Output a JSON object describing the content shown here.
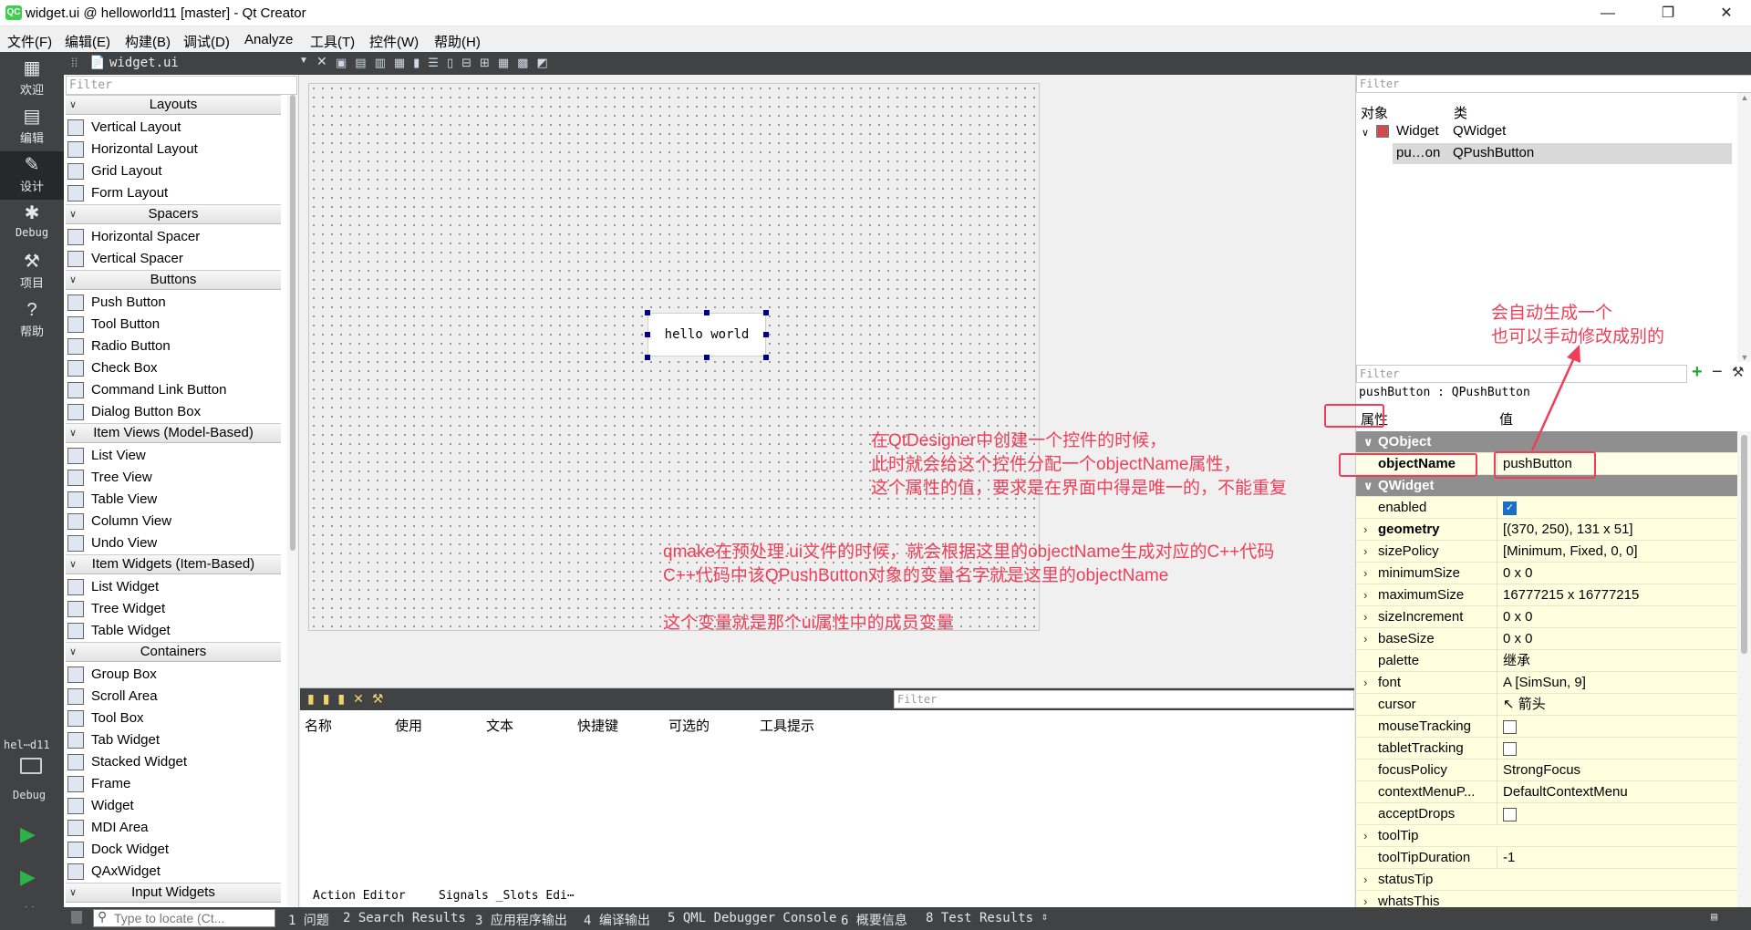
{
  "window": {
    "title": "widget.ui @ helloworld11 [master] - Qt Creator",
    "logo": "QC"
  },
  "menubar": [
    "文件(F)",
    "编辑(E)",
    "构建(B)",
    "调试(D)",
    "Analyze",
    "工具(T)",
    "控件(W)",
    "帮助(H)"
  ],
  "modebar": {
    "modes": [
      {
        "label": "欢迎",
        "icon": "grid-icon"
      },
      {
        "label": "编辑",
        "icon": "document-icon"
      },
      {
        "label": "设计",
        "icon": "pencil-icon",
        "active": true
      },
      {
        "label": "Debug",
        "icon": "bug-icon"
      },
      {
        "label": "项目",
        "icon": "wrench-icon"
      },
      {
        "label": "帮助",
        "icon": "help-icon"
      }
    ],
    "project": "hel⋯d11",
    "kit": "Debug"
  },
  "editor": {
    "file_tab": "widget.ui"
  },
  "widgetbox": {
    "filter_placeholder": "Filter",
    "categories": [
      {
        "name": "Layouts",
        "items": [
          "Vertical Layout",
          "Horizontal Layout",
          "Grid Layout",
          "Form Layout"
        ]
      },
      {
        "name": "Spacers",
        "items": [
          "Horizontal Spacer",
          "Vertical Spacer"
        ]
      },
      {
        "name": "Buttons",
        "items": [
          "Push Button",
          "Tool Button",
          "Radio Button",
          "Check Box",
          "Command Link Button",
          "Dialog Button Box"
        ]
      },
      {
        "name": "Item Views (Model-Based)",
        "items": [
          "List View",
          "Tree View",
          "Table View",
          "Column View",
          "Undo View"
        ]
      },
      {
        "name": "Item Widgets (Item-Based)",
        "items": [
          "List Widget",
          "Tree Widget",
          "Table Widget"
        ]
      },
      {
        "name": "Containers",
        "items": [
          "Group Box",
          "Scroll Area",
          "Tool Box",
          "Tab Widget",
          "Stacked Widget",
          "Frame",
          "Widget",
          "MDI Area",
          "Dock Widget",
          "QAxWidget"
        ]
      },
      {
        "name": "Input Widgets",
        "items": []
      }
    ]
  },
  "form": {
    "button_text": "hello world"
  },
  "action_editor": {
    "filter_placeholder": "Filter",
    "columns": [
      "名称",
      "使用",
      "文本",
      "快捷键",
      "可选的",
      "工具提示"
    ],
    "tabs": [
      "Action Editor",
      "Signals _Slots Edi⋯"
    ]
  },
  "object_inspector": {
    "filter_placeholder": "Filter",
    "col_object": "对象",
    "col_class": "类",
    "rows": [
      {
        "object": "Widget",
        "class": "QWidget"
      },
      {
        "object": "pu…on",
        "class": "QPushButton"
      }
    ]
  },
  "property_editor": {
    "filter_placeholder": "Filter",
    "current": "pushButton : QPushButton",
    "col_prop": "属性",
    "col_value": "值",
    "rows": [
      {
        "kind": "header",
        "name": "QObject"
      },
      {
        "kind": "prop",
        "name": "objectName",
        "value": "pushButton",
        "bold": true
      },
      {
        "kind": "header",
        "name": "QWidget"
      },
      {
        "kind": "check",
        "name": "enabled",
        "checked": true
      },
      {
        "kind": "prop",
        "name": "geometry",
        "value": "[(370, 250), 131 x 51]",
        "bold": true,
        "expand": true
      },
      {
        "kind": "prop",
        "name": "sizePolicy",
        "value": "[Minimum, Fixed, 0, 0]",
        "expand": true
      },
      {
        "kind": "prop",
        "name": "minimumSize",
        "value": "0 x 0",
        "expand": true
      },
      {
        "kind": "prop",
        "name": "maximumSize",
        "value": "16777215 x 16777215",
        "expand": true
      },
      {
        "kind": "prop",
        "name": "sizeIncrement",
        "value": "0 x 0",
        "expand": true
      },
      {
        "kind": "prop",
        "name": "baseSize",
        "value": "0 x 0",
        "expand": true
      },
      {
        "kind": "prop",
        "name": "palette",
        "value": "继承"
      },
      {
        "kind": "prop",
        "name": "font",
        "value": "A  [SimSun, 9]",
        "expand": true
      },
      {
        "kind": "prop",
        "name": "cursor",
        "value": "↖  箭头"
      },
      {
        "kind": "check",
        "name": "mouseTracking",
        "checked": false
      },
      {
        "kind": "check",
        "name": "tabletTracking",
        "checked": false
      },
      {
        "kind": "prop",
        "name": "focusPolicy",
        "value": "StrongFocus"
      },
      {
        "kind": "prop",
        "name": "contextMenuP...",
        "value": "DefaultContextMenu"
      },
      {
        "kind": "check",
        "name": "acceptDrops",
        "checked": false
      },
      {
        "kind": "prop",
        "name": "toolTip",
        "value": "",
        "expand": true
      },
      {
        "kind": "prop",
        "name": "toolTipDuration",
        "value": "-1"
      },
      {
        "kind": "prop",
        "name": "statusTip",
        "value": "",
        "expand": true
      },
      {
        "kind": "prop",
        "name": "whatsThis",
        "value": "",
        "expand": true
      }
    ]
  },
  "annotations": {
    "top_right": [
      "会自动生成一个",
      "也可以手动修改成别的"
    ],
    "middle": [
      "在QtDesigner中创建一个控件的时候，",
      "此时就会给这个控件分配一个objectName属性，",
      "这个属性的值，要求是在界面中得是唯一的，不能重复"
    ],
    "bottom": [
      "qmake在预处理.ui文件的时候，就会根据这里的objectName生成对应的C++代码",
      "C++代码中该QPushButton对象的变量名字就是这里的objectName",
      "",
      "这个变量就是那个ui属性中的成员变量"
    ],
    "color": "#f03e58"
  },
  "statusbar": {
    "locate_placeholder": "Type to locate (Ct...",
    "panes": [
      "1 问题",
      "2 Search Results",
      "3 应用程序输出",
      "4 编译输出",
      "5 QML Debugger Console",
      "6 概要信息",
      "8 Test Results"
    ]
  }
}
